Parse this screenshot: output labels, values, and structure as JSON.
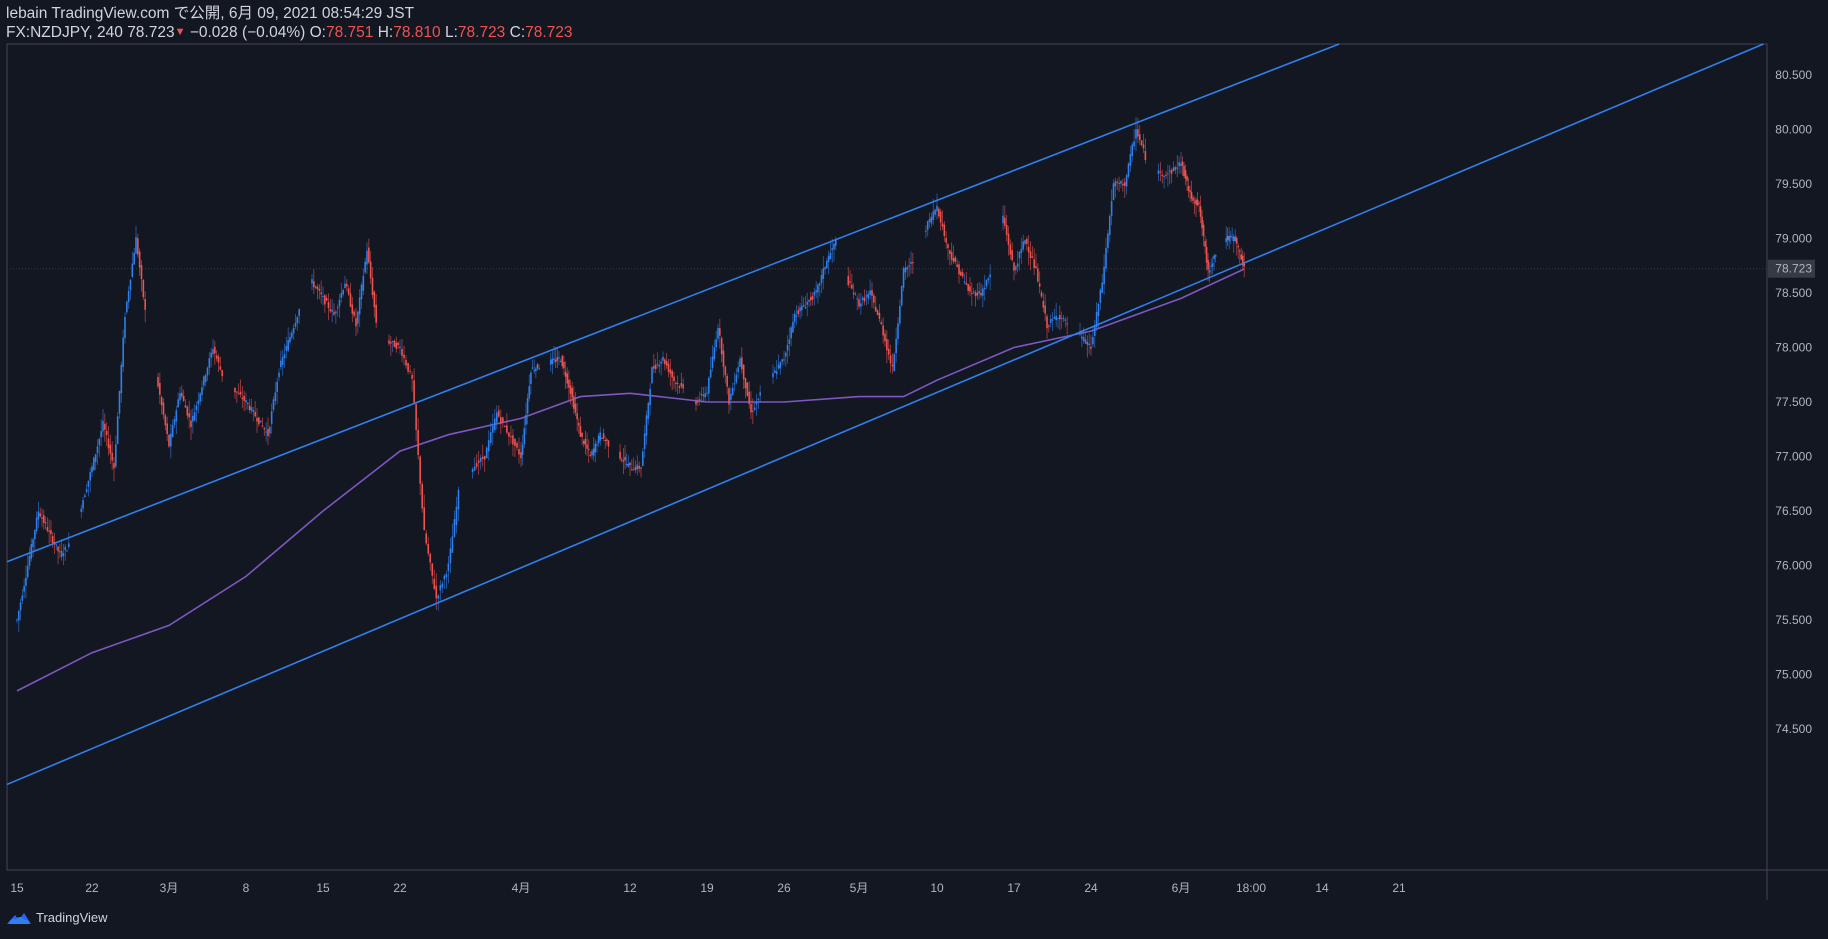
{
  "header": {
    "publish_line": "lebain TradingView.com で公開, 6月 09, 2021 08:54:29 JST",
    "symbol": "FX:NZDJPY, 240",
    "last": "78.723",
    "change": "−0.028 (−0.04%)",
    "o_label": "O:",
    "o_value": "78.751",
    "h_label": "H:",
    "h_value": "78.810",
    "l_label": "L:",
    "l_value": "78.723",
    "c_label": "C:",
    "c_value": "78.723"
  },
  "footer": {
    "brand": "TradingView"
  },
  "colors": {
    "background": "#131722",
    "bull": "#2962ff",
    "bull_alt": "#2f80ed",
    "bear": "#ef5350",
    "channel": "#2f80ed",
    "ma": "#7e57c2",
    "last_label_bg": "#363a45"
  },
  "chart_data": {
    "type": "candlestick",
    "symbol": "FX:NZDJPY",
    "interval": "240",
    "last_price": 78.723,
    "ylim": [
      74.3,
      80.95
    ],
    "y_ticks": [
      "74.500",
      "75.000",
      "75.500",
      "76.000",
      "76.500",
      "77.000",
      "77.500",
      "78.000",
      "78.500",
      "79.000",
      "79.500",
      "80.000",
      "80.500"
    ],
    "x_ticks": [
      "15",
      "22",
      "3月",
      "8",
      "15",
      "22",
      "4月",
      "12",
      "19",
      "26",
      "5月",
      "10",
      "17",
      "24",
      "6月",
      "18:00",
      "14",
      "21"
    ],
    "x_tick_dates": [
      "2021-02-15",
      "2021-02-22",
      "2021-03-01",
      "2021-03-08",
      "2021-03-15",
      "2021-03-22",
      "2021-04-01",
      "2021-04-12",
      "2021-04-19",
      "2021-04-26",
      "2021-05-03",
      "2021-05-10",
      "2021-05-17",
      "2021-05-24",
      "2021-06-01",
      "2021-06-08 18:00",
      "2021-06-14",
      "2021-06-21"
    ],
    "price_path": [
      [
        "2021-02-15",
        75.5
      ],
      [
        "2021-02-17",
        76.5
      ],
      [
        "2021-02-19",
        76.1
      ],
      [
        "2021-02-20",
        76.2
      ],
      [
        "2021-02-22",
        76.9
      ],
      [
        "2021-02-23",
        77.3
      ],
      [
        "2021-02-24",
        76.9
      ],
      [
        "2021-02-25",
        78.3
      ],
      [
        "2021-02-26",
        79.0
      ],
      [
        "2021-02-27",
        78.2
      ],
      [
        "2021-03-01",
        77.1
      ],
      [
        "2021-03-02",
        77.6
      ],
      [
        "2021-03-03",
        77.3
      ],
      [
        "2021-03-05",
        78.0
      ],
      [
        "2021-03-06",
        77.7
      ],
      [
        "2021-03-08",
        77.5
      ],
      [
        "2021-03-10",
        77.2
      ],
      [
        "2021-03-11",
        77.8
      ],
      [
        "2021-03-13",
        78.4
      ],
      [
        "2021-03-14",
        78.6
      ],
      [
        "2021-03-16",
        78.3
      ],
      [
        "2021-03-17",
        78.6
      ],
      [
        "2021-03-18",
        78.2
      ],
      [
        "2021-03-19",
        78.9
      ],
      [
        "2021-03-20",
        78.1
      ],
      [
        "2021-03-22",
        78.0
      ],
      [
        "2021-03-23",
        77.7
      ],
      [
        "2021-03-24",
        76.3
      ],
      [
        "2021-03-25",
        75.7
      ],
      [
        "2021-03-26",
        76.0
      ],
      [
        "2021-03-27",
        76.8
      ],
      [
        "2021-03-29",
        77.0
      ],
      [
        "2021-03-30",
        77.4
      ],
      [
        "2021-04-01",
        77.0
      ],
      [
        "2021-04-02",
        77.8
      ],
      [
        "2021-04-05",
        77.9
      ],
      [
        "2021-04-06",
        77.6
      ],
      [
        "2021-04-07",
        77.2
      ],
      [
        "2021-04-08",
        77.0
      ],
      [
        "2021-04-09",
        77.2
      ],
      [
        "2021-04-12",
        76.9
      ],
      [
        "2021-04-13",
        76.9
      ],
      [
        "2021-04-14",
        77.8
      ],
      [
        "2021-04-15",
        77.9
      ],
      [
        "2021-04-16",
        77.7
      ],
      [
        "2021-04-18",
        77.5
      ],
      [
        "2021-04-19",
        77.6
      ],
      [
        "2021-04-20",
        78.2
      ],
      [
        "2021-04-21",
        77.5
      ],
      [
        "2021-04-22",
        77.9
      ],
      [
        "2021-04-23",
        77.4
      ],
      [
        "2021-04-24",
        77.6
      ],
      [
        "2021-04-26",
        77.9
      ],
      [
        "2021-04-27",
        78.3
      ],
      [
        "2021-04-29",
        78.5
      ],
      [
        "2021-04-30",
        78.8
      ],
      [
        "2021-05-01",
        79.0
      ],
      [
        "2021-05-02",
        78.6
      ],
      [
        "2021-05-03",
        78.4
      ],
      [
        "2021-05-04",
        78.5
      ],
      [
        "2021-05-05",
        78.2
      ],
      [
        "2021-05-06",
        77.8
      ],
      [
        "2021-05-07",
        78.7
      ],
      [
        "2021-05-08",
        78.8
      ],
      [
        "2021-05-09",
        79.1
      ],
      [
        "2021-05-10",
        79.3
      ],
      [
        "2021-05-11",
        78.9
      ],
      [
        "2021-05-13",
        78.5
      ],
      [
        "2021-05-14",
        78.5
      ],
      [
        "2021-05-15",
        78.7
      ],
      [
        "2021-05-16",
        79.2
      ],
      [
        "2021-05-17",
        78.7
      ],
      [
        "2021-05-18",
        79.0
      ],
      [
        "2021-05-19",
        78.7
      ],
      [
        "2021-05-20",
        78.2
      ],
      [
        "2021-05-21",
        78.3
      ],
      [
        "2021-05-22",
        78.2
      ],
      [
        "2021-05-23",
        78.1
      ],
      [
        "2021-05-24",
        78.0
      ],
      [
        "2021-05-25",
        78.6
      ],
      [
        "2021-05-26",
        79.5
      ],
      [
        "2021-05-27",
        79.5
      ],
      [
        "2021-05-28",
        80.0
      ],
      [
        "2021-05-29",
        79.7
      ],
      [
        "2021-05-30",
        79.6
      ],
      [
        "2021-05-31",
        79.6
      ],
      [
        "2021-06-01",
        79.7
      ],
      [
        "2021-06-02",
        79.4
      ],
      [
        "2021-06-03",
        79.3
      ],
      [
        "2021-06-04",
        78.7
      ],
      [
        "2021-06-05",
        78.9
      ],
      [
        "2021-06-06",
        79.0
      ],
      [
        "2021-06-07",
        79.0
      ],
      [
        "2021-06-08",
        78.723
      ]
    ],
    "moving_average": {
      "color": "#7e57c2",
      "points": [
        [
          "2021-02-15",
          74.85
        ],
        [
          "2021-02-22",
          75.2
        ],
        [
          "2021-03-01",
          75.45
        ],
        [
          "2021-03-08",
          75.9
        ],
        [
          "2021-03-15",
          76.5
        ],
        [
          "2021-03-22",
          77.05
        ],
        [
          "2021-03-26",
          77.2
        ],
        [
          "2021-04-01",
          77.35
        ],
        [
          "2021-04-07",
          77.55
        ],
        [
          "2021-04-12",
          77.58
        ],
        [
          "2021-04-19",
          77.5
        ],
        [
          "2021-04-26",
          77.5
        ],
        [
          "2021-05-03",
          77.55
        ],
        [
          "2021-05-07",
          77.55
        ],
        [
          "2021-05-10",
          77.7
        ],
        [
          "2021-05-17",
          78.0
        ],
        [
          "2021-05-24",
          78.15
        ],
        [
          "2021-06-01",
          78.45
        ],
        [
          "2021-06-08",
          78.72
        ]
      ]
    },
    "channel": {
      "color": "#2f80ed",
      "upper": [
        [
          "2021-02-15",
          76.07
        ],
        [
          "2021-06-18",
          80.88
        ]
      ],
      "lower": [
        [
          "2021-02-15",
          74.03
        ],
        [
          "2021-06-24",
          79.5
        ]
      ]
    }
  }
}
